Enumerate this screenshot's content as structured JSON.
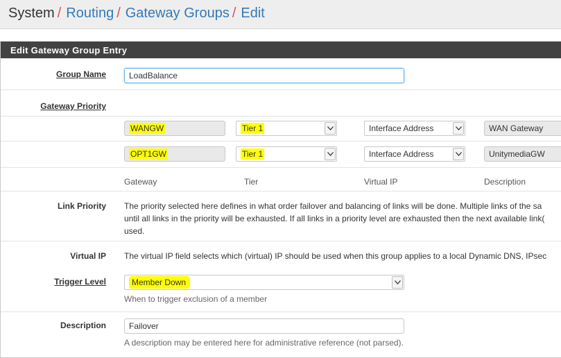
{
  "breadcrumb": {
    "root": "System",
    "sep": "/",
    "items": [
      "Routing",
      "Gateway Groups",
      "Edit"
    ]
  },
  "panel": {
    "title": "Edit Gateway Group Entry"
  },
  "group_name": {
    "label": "Group Name",
    "value": "LoadBalance"
  },
  "gateway_priority": {
    "label": "Gateway Priority",
    "rows": [
      {
        "gateway": "WANGW",
        "tier": "Tier 1",
        "vip": "Interface Address",
        "description": "WAN Gateway"
      },
      {
        "gateway": "OPT1GW",
        "tier": "Tier 1",
        "vip": "Interface Address",
        "description": "UnitymediaGW"
      }
    ],
    "columns": {
      "gateway": "Gateway",
      "tier": "Tier",
      "vip": "Virtual IP",
      "description": "Description"
    }
  },
  "link_priority": {
    "label": "Link Priority",
    "lines": [
      "The priority selected here defines in what order failover and balancing of links will be done. Multiple links of the sa",
      "until all links in the priority will be exhausted. If all links in a priority level are exhausted then the next available link(",
      "used."
    ]
  },
  "virtual_ip": {
    "label": "Virtual IP",
    "text": "The virtual IP field selects which (virtual) IP should be used when this group applies to a local Dynamic DNS, IPsec"
  },
  "trigger_level": {
    "label": "Trigger Level",
    "value": "Member Down",
    "help": "When to trigger exclusion of a member"
  },
  "description": {
    "label": "Description",
    "value": "Failover",
    "help": "A description may be entered here for administrative reference (not parsed)."
  },
  "colors": {
    "highlight": "#ffff00",
    "link": "#337ab7",
    "separator": "#d9534f",
    "panel_heading": "#424242"
  }
}
